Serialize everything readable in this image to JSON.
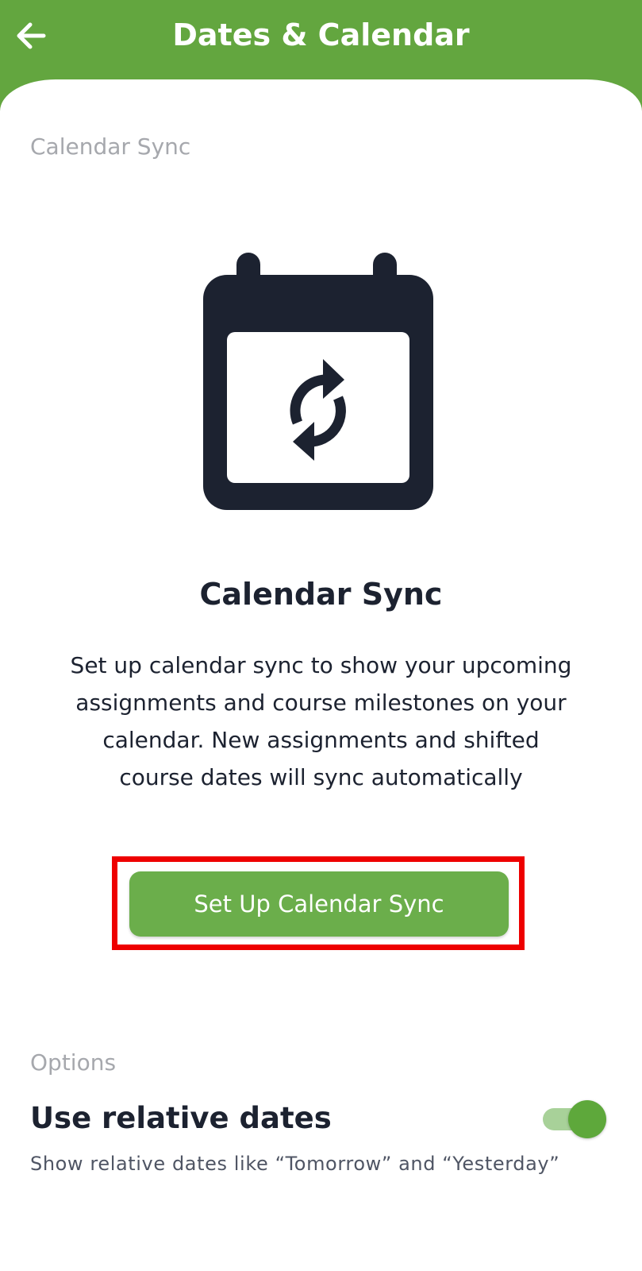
{
  "header": {
    "title": "Dates & Calendar",
    "back_icon": "arrow-left-icon",
    "background_color": "#63a63f"
  },
  "calendar_sync_section": {
    "label": "Calendar Sync",
    "icon": "calendar-sync-icon",
    "title": "Calendar Sync",
    "description": "Set up calendar sync to show your upcoming assignments and course milestones on your calendar. New assignments and shifted course dates will sync automatically",
    "button_label": "Set Up Calendar Sync",
    "button_color": "#6bae4b",
    "highlight_color": "#ee0000"
  },
  "options_section": {
    "label": "Options",
    "relative_dates": {
      "title": "Use relative dates",
      "description": "Show relative dates like “Tomorrow” and “Yesterday”",
      "enabled": true
    }
  }
}
